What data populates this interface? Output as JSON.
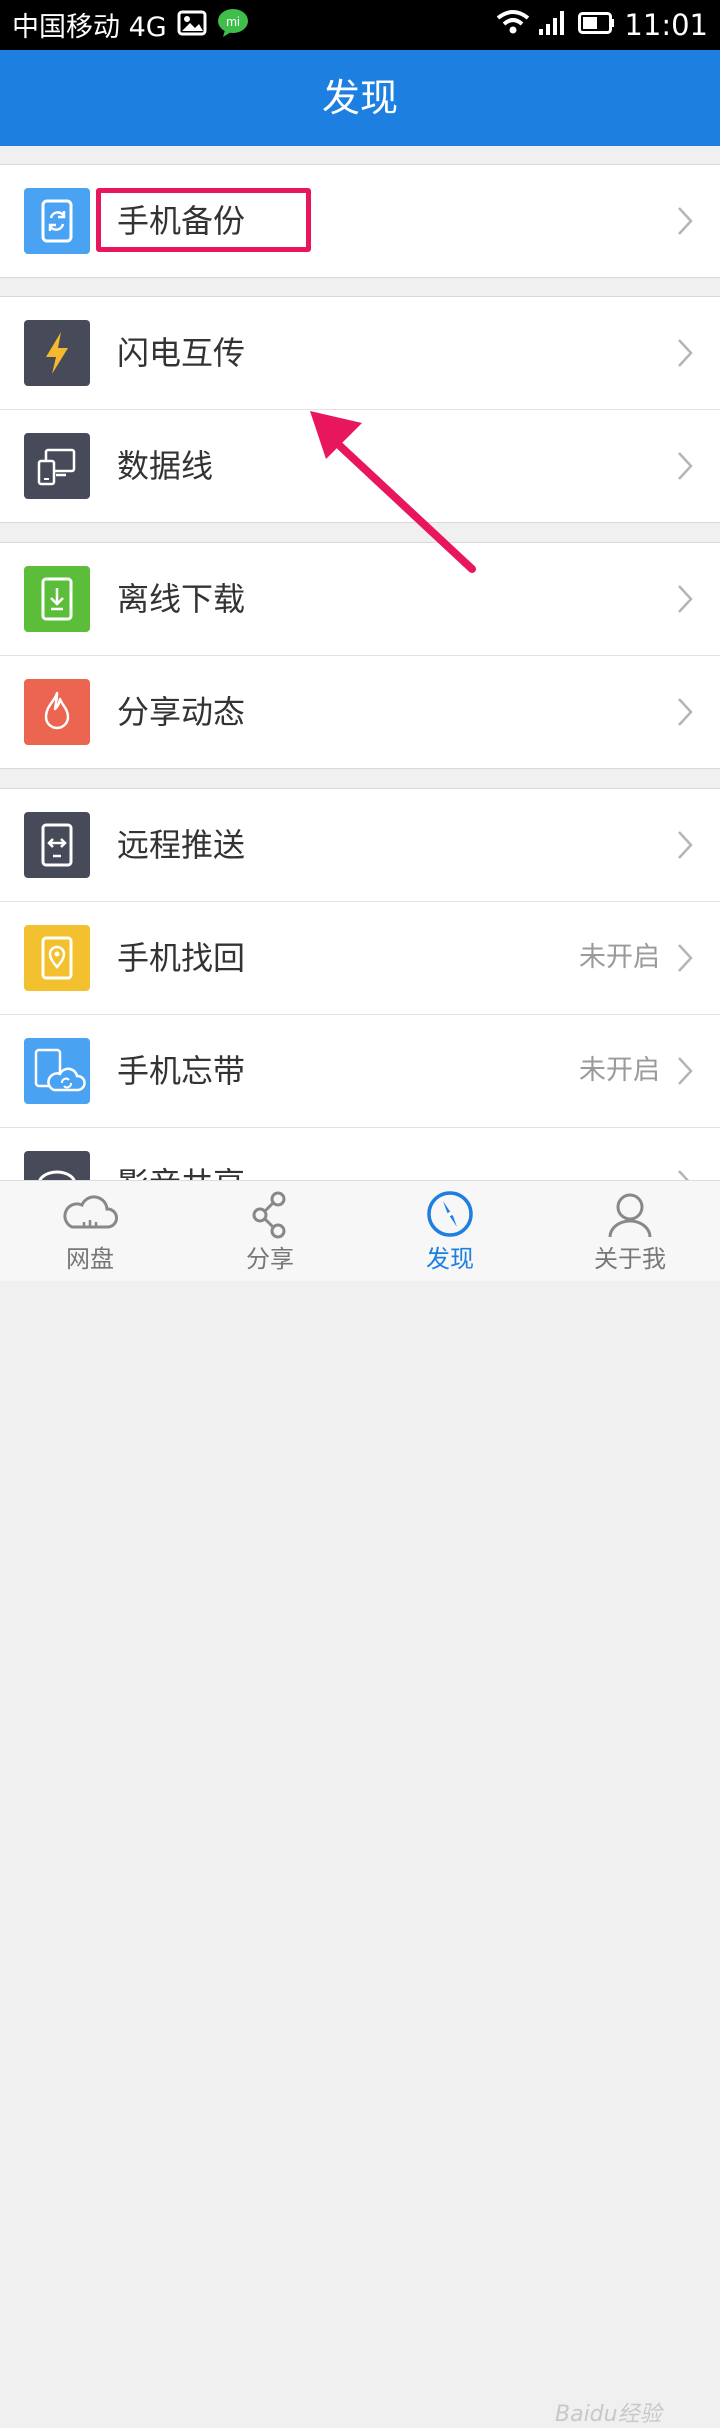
{
  "status_bar": {
    "carrier": "中国移动 4G",
    "time": "11:01"
  },
  "header": {
    "title": "发现"
  },
  "menu": [
    {
      "label": "手机备份",
      "status": "",
      "icon": "phone-sync-icon",
      "color": "#4aa3f2"
    },
    {
      "label": "闪电互传",
      "status": "",
      "icon": "lightning-icon",
      "color": "#474a58"
    },
    {
      "label": "数据线",
      "status": "",
      "icon": "devices-icon",
      "color": "#474a58"
    },
    {
      "label": "离线下载",
      "status": "",
      "icon": "download-icon",
      "color": "#5cbd3a"
    },
    {
      "label": "分享动态",
      "status": "",
      "icon": "flame-icon",
      "color": "#ec6550"
    },
    {
      "label": "远程推送",
      "status": "",
      "icon": "remote-push-icon",
      "color": "#474a58"
    },
    {
      "label": "手机找回",
      "status": "未开启",
      "icon": "location-pin-icon",
      "color": "#f3c12f"
    },
    {
      "label": "手机忘带",
      "status": "未开启",
      "icon": "phone-cloud-icon",
      "color": "#4aa3f2"
    },
    {
      "label": "影音共享",
      "status": "",
      "icon": "media-icon",
      "color": "#474a58"
    }
  ],
  "tabs": [
    {
      "label": "网盘",
      "icon": "cloud-icon",
      "active": false
    },
    {
      "label": "分享",
      "icon": "share-icon",
      "active": false
    },
    {
      "label": "发现",
      "icon": "compass-icon",
      "active": true
    },
    {
      "label": "关于我",
      "icon": "user-icon",
      "active": false
    }
  ],
  "watermark": "Baidu经验",
  "colors": {
    "accent": "#1d7fe0",
    "highlight": "#e8175d"
  }
}
